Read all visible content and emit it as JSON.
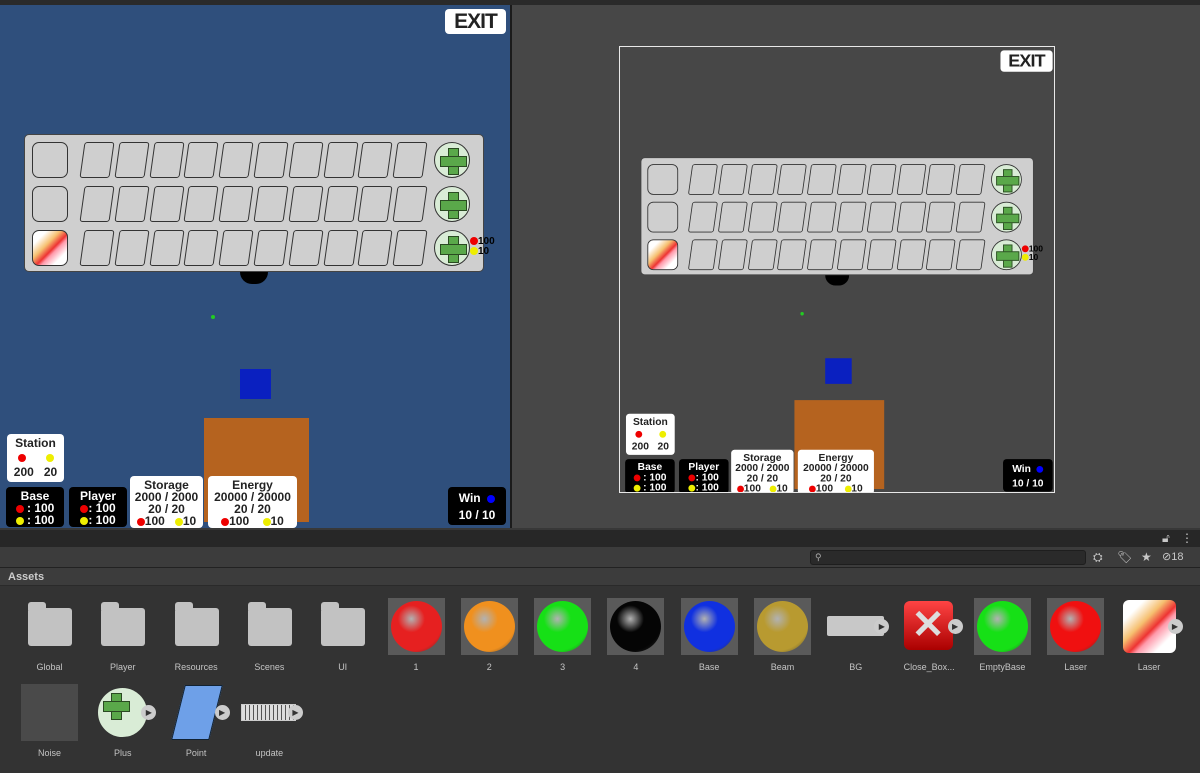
{
  "game": {
    "exit_label": "EXIT",
    "inventory": {
      "rows": 3,
      "slots_per_row": 10,
      "row3_cost_red": "100",
      "row3_cost_yellow": "10"
    },
    "station": {
      "title": "Station",
      "red": "200",
      "yellow": "20"
    },
    "base": {
      "title": "Base",
      "red": ": 100",
      "yellow": ": 100"
    },
    "player": {
      "title": "Player",
      "red": ": 100",
      "yellow": ": 100"
    },
    "storage": {
      "title": "Storage",
      "line1": "2000 / 2000",
      "line2": "20 / 20",
      "red": "100",
      "yellow": "10"
    },
    "energy": {
      "title": "Energy",
      "line1": "20000 / 20000",
      "line2": "20 / 20",
      "red": "100",
      "yellow": "10"
    },
    "win": {
      "title": "Win",
      "value": "10 / 10"
    }
  },
  "project": {
    "header": "Assets",
    "search_placeholder": "",
    "hidden_count": "18",
    "assets": [
      {
        "name": "Global",
        "type": "folder"
      },
      {
        "name": "Player",
        "type": "folder"
      },
      {
        "name": "Resources",
        "type": "folder"
      },
      {
        "name": "Scenes",
        "type": "folder"
      },
      {
        "name": "UI",
        "type": "folder"
      },
      {
        "name": "1",
        "type": "material",
        "color": "#e62020"
      },
      {
        "name": "2",
        "type": "material",
        "color": "#f0901e"
      },
      {
        "name": "3",
        "type": "material",
        "color": "#16e016"
      },
      {
        "name": "4",
        "type": "material",
        "color": "#050505"
      },
      {
        "name": "Base",
        "type": "material",
        "color": "#1030e0"
      },
      {
        "name": "Beam",
        "type": "material",
        "color": "#b89a30"
      },
      {
        "name": "BG",
        "type": "sprite"
      },
      {
        "name": "Close_Box...",
        "type": "sprite"
      },
      {
        "name": "EmptyBase",
        "type": "material",
        "color": "#16e016"
      },
      {
        "name": "Laser",
        "type": "material",
        "color": "#f01010"
      },
      {
        "name": "Laser",
        "type": "sprite"
      },
      {
        "name": "Noise",
        "type": "texture"
      },
      {
        "name": "Plus",
        "type": "sprite"
      },
      {
        "name": "Point",
        "type": "sprite"
      },
      {
        "name": "update",
        "type": "sprite"
      }
    ]
  }
}
